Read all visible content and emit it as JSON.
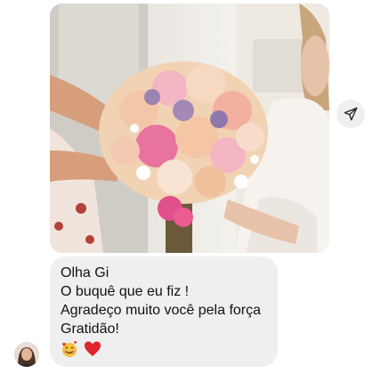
{
  "message": {
    "lines": [
      "Olha Gi",
      "O buquê que eu fiz !",
      "Agradeço muito você pela força",
      "Gratidão!"
    ],
    "emojis": [
      "smiling-face-with-hearts",
      "red-heart"
    ]
  },
  "photo": {
    "subject": "bridal-bouquet-photo"
  },
  "icons": {
    "share": "send-arrow-icon"
  }
}
